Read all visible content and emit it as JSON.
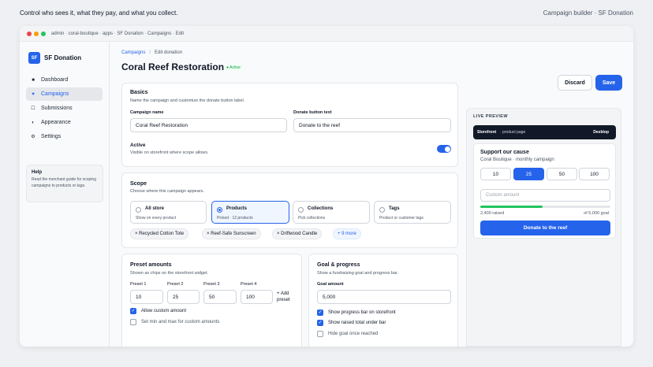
{
  "page": {
    "tagline": "Control who sees it, what they pay, and what you collect.",
    "context": "Campaign builder · SF Donation"
  },
  "window": {
    "url": "admin · coral-boutique · apps · SF Donation · Campaigns · Edit"
  },
  "sidebar": {
    "logo": "SF",
    "app_name": "SF Donation",
    "items": [
      {
        "label": "Dashboard",
        "icon": "■"
      },
      {
        "label": "Campaigns",
        "icon": "♥"
      },
      {
        "label": "Submissions",
        "icon": "☐"
      },
      {
        "label": "Appearance",
        "icon": "◐"
      },
      {
        "label": "Settings",
        "icon": "⚙"
      }
    ],
    "help": {
      "title": "Help",
      "text": "Read the merchant guide for scoping campaigns to products or tags."
    }
  },
  "header": {
    "breadcrumb_root": "Campaigns",
    "breadcrumb_sep": "/",
    "breadcrumb_current": "Edit donation",
    "title": "Coral Reef Restoration",
    "status": "● Active",
    "discard": "Discard",
    "save": "Save"
  },
  "basics": {
    "title": "Basics",
    "subtitle": "Name the campaign and customize the donate button label.",
    "name_label": "Campaign name",
    "name_value": "Coral Reef Restoration",
    "button_label": "Donate button text",
    "button_value": "Donate to the reef",
    "active_label": "Active",
    "active_sub": "Visible on storefront where scope allows."
  },
  "scope": {
    "title": "Scope",
    "subtitle": "Choose where this campaign appears.",
    "options": [
      {
        "title": "All store",
        "sub": "Show on every product"
      },
      {
        "title": "Products",
        "sub": "Picked · 12 products"
      },
      {
        "title": "Collections",
        "sub": "Pick collections"
      },
      {
        "title": "Tags",
        "sub": "Product or customer tags"
      }
    ],
    "chips": [
      "× Recycled Cotton Tote",
      "× Reef-Safe Sunscreen",
      "× Driftwood Candle"
    ],
    "more": "+ 9 more"
  },
  "presets": {
    "title": "Preset amounts",
    "subtitle": "Shown as chips on the storefront widget.",
    "labels": [
      "Preset 1",
      "Preset 2",
      "Preset 3",
      "Preset 4"
    ],
    "values": [
      "10",
      "25",
      "50",
      "100"
    ],
    "add_line1": "+ Add",
    "add_line2": "preset",
    "allow_custom": "Allow custom amount",
    "min_max": "Set min and max for custom amounts"
  },
  "goal": {
    "title": "Goal & progress",
    "subtitle": "Show a fundraising goal and progress bar.",
    "amount_label": "Goal amount",
    "amount_value": "5,000",
    "show_bar": "Show progress bar on storefront",
    "show_total": "Show raised total under bar",
    "hide_reached": "Hide goal once reached"
  },
  "preview": {
    "label": "LIVE PREVIEW",
    "store": "Storefront",
    "page": "· product page",
    "device": "Desktop",
    "heading": "Support our cause",
    "sub": "Coral Boutique · monthly campaign",
    "amounts": [
      "10",
      "25",
      "50",
      "100"
    ],
    "custom_placeholder": "Custom amount",
    "raised": "2,400 raised",
    "goal": "of 5,000 goal",
    "progress": 0.48,
    "donate": "Donate to the reef"
  },
  "colors": {
    "accent": "#2563eb",
    "success": "#16a34a",
    "dark": "#111827"
  }
}
